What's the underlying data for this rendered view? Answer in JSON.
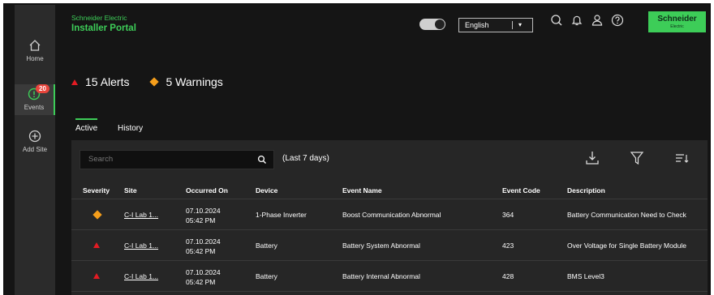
{
  "brand": {
    "company": "Schneider Electric",
    "title": "Installer Portal",
    "logo_main": "Schneider",
    "logo_sub": "Electric",
    "accent": "#3dcd58"
  },
  "sidebar": {
    "items": [
      {
        "label": "Home",
        "icon": "home-icon"
      },
      {
        "label": "Events",
        "icon": "alert-circle-icon",
        "badge": "20"
      },
      {
        "label": "Add Site",
        "icon": "plus-circle-icon"
      }
    ]
  },
  "topbar": {
    "language": "English",
    "icons": [
      "search-icon",
      "bell-icon",
      "user-icon",
      "help-icon"
    ]
  },
  "summary": {
    "alerts": "15 Alerts",
    "warnings": "5 Warnings"
  },
  "tabs": [
    {
      "label": "Active"
    },
    {
      "label": "History"
    }
  ],
  "filters": {
    "search_placeholder": "Search",
    "period": "(Last 7 days)"
  },
  "table": {
    "columns": [
      "Severity",
      "Site",
      "Occurred On",
      "Device",
      "Event Name",
      "Event Code",
      "Description"
    ],
    "rows": [
      {
        "severity": "warning",
        "site": "C-I Lab 1...",
        "date": "07.10.2024",
        "time": "05:42 PM",
        "device": "1-Phase Inverter",
        "event": "Boost Communication Abnormal",
        "code": "364",
        "description": "Battery Communication Need to Check"
      },
      {
        "severity": "alert",
        "site": "C-I Lab 1...",
        "date": "07.10.2024",
        "time": "05:42 PM",
        "device": "Battery",
        "event": "Battery System Abnormal",
        "code": "423",
        "description": "Over Voltage for Single Battery Module"
      },
      {
        "severity": "alert",
        "site": "C-I Lab 1...",
        "date": "07.10.2024",
        "time": "05:42 PM",
        "device": "Battery",
        "event": "Battery Internal Abnormal",
        "code": "428",
        "description": "BMS Level3"
      }
    ]
  },
  "colors": {
    "alert": "#e31b23",
    "warning": "#f59e1b",
    "badge": "#e8453c"
  }
}
